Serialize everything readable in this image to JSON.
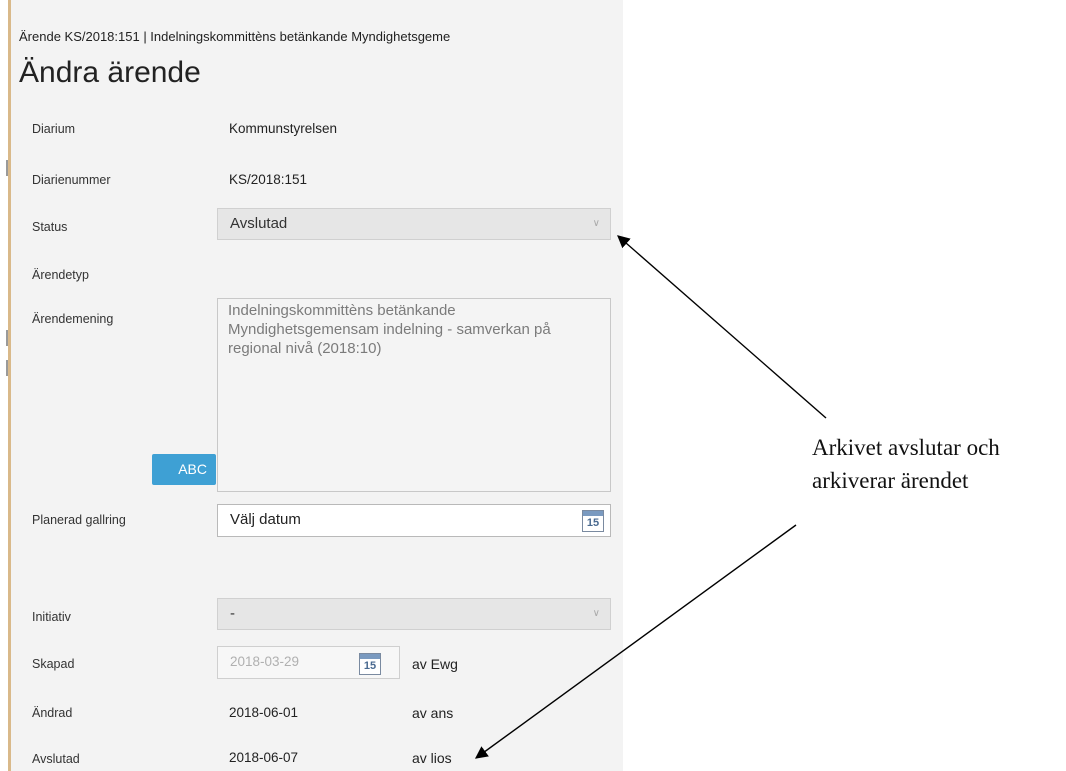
{
  "window": {
    "title": "Ärende KS/2018:151 | Indelningskommittèns betänkande Myndighetsgeme"
  },
  "page": {
    "title": "Ändra ärende"
  },
  "fields": {
    "diarium": {
      "label": "Diarium",
      "value": "Kommunstyrelsen"
    },
    "diarienummer": {
      "label": "Diarienummer",
      "value": "KS/2018:151"
    },
    "status": {
      "label": "Status",
      "value": "Avslutad"
    },
    "arendetyp": {
      "label": "Ärendetyp"
    },
    "arendemening": {
      "label": "Ärendemening",
      "value": "Indelningskommittèns betänkande Myndighetsgemensam indelning - samverkan på regional nivå (2018:10)",
      "spell_button": "ABC"
    },
    "planerad_gallring": {
      "label": "Planerad gallring",
      "placeholder": "Välj datum",
      "calendar_day": "15"
    },
    "initiativ": {
      "label": "Initiativ",
      "value": "-"
    },
    "skapad": {
      "label": "Skapad",
      "date": "2018-03-29",
      "calendar_day": "15",
      "by": "av Ewg"
    },
    "andrad": {
      "label": "Ändrad",
      "date": "2018-06-01",
      "by": "av ans"
    },
    "avslutad": {
      "label": "Avslutad",
      "date": "2018-06-07",
      "by": "av lios"
    }
  },
  "annotation": {
    "line1": "Arkivet avslutar och",
    "line2": "arkiverar ärendet"
  }
}
